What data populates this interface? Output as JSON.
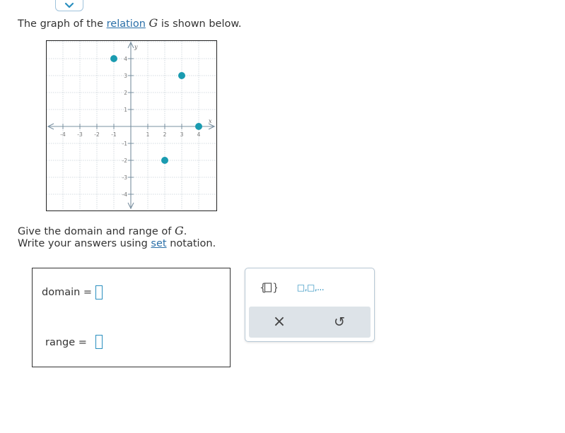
{
  "prompt": {
    "part1": "The graph of the ",
    "relation_link": "relation",
    "var": "G",
    "part2": " is shown below."
  },
  "graph": {
    "x_axis_label": "x",
    "y_axis_label": "y",
    "tick_labels": [
      "-4",
      "-3",
      "-2",
      "-1",
      "1",
      "2",
      "3",
      "4"
    ],
    "points": [
      {
        "x": -1,
        "y": 4
      },
      {
        "x": 3,
        "y": 3
      },
      {
        "x": 4,
        "y": 0
      },
      {
        "x": 2,
        "y": -2
      }
    ],
    "point_color": "#1a9bb0",
    "axis_color": "#7a90a0"
  },
  "question": {
    "line1_part1": "Give the domain and range of ",
    "line1_var": "G",
    "line1_end": ".",
    "line2_part1": "Write your answers using ",
    "line2_link": "set",
    "line2_part2": " notation."
  },
  "answers": {
    "domain_label": "domain",
    "range_label": "range",
    "equals": "="
  },
  "palette": {
    "set_brackets_icon": "set-brackets-icon",
    "list_icon_text": "□,□,...",
    "clear_symbol": "×",
    "undo_symbol": "↺"
  }
}
